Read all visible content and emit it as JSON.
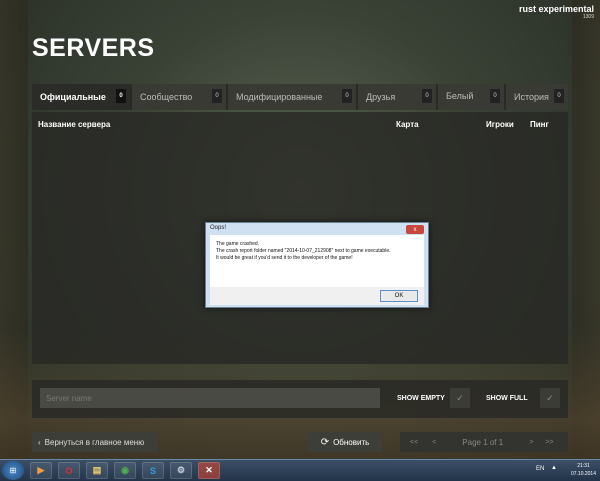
{
  "app": {
    "name": "rust experimental",
    "build": "1309"
  },
  "page": {
    "title": "SERVERS"
  },
  "tabs": [
    {
      "label": "Официальные",
      "count": "0"
    },
    {
      "label": "Сообщество",
      "count": "0"
    },
    {
      "label": "Модифицированные",
      "count": "0"
    },
    {
      "label": "Друзья",
      "count": "0"
    },
    {
      "label": "Белый список",
      "count": "0"
    },
    {
      "label": "История",
      "count": "0"
    }
  ],
  "columns": {
    "name": "Название сервера",
    "map": "Карта",
    "players": "Игроки",
    "ping": "Пинг"
  },
  "filters": {
    "search_placeholder": "Server name",
    "show_empty": "SHOW EMPTY",
    "show_full": "SHOW FULL"
  },
  "footer": {
    "back_label": "Вернуться в главное меню",
    "refresh_label": "Обновить",
    "pager": {
      "first": "<<",
      "prev": "<",
      "page": "Page 1 of 1",
      "next": ">",
      "last": ">>"
    }
  },
  "dialog": {
    "title": "Oops!",
    "close": "x",
    "line1": "The game crashed.",
    "line2": "The crash report folder named \"2014-10-07_212908\" next to game executable.",
    "line3": "It would be great if you'd send it to the developer of the game!",
    "ok": "OK"
  },
  "taskbar": {
    "language": "EN",
    "time": "21:31",
    "date": "07.10.2014"
  },
  "colors": {
    "accent": "#3a3a34",
    "dialog": "#cfe0f2",
    "taskbar": "#22344a"
  }
}
